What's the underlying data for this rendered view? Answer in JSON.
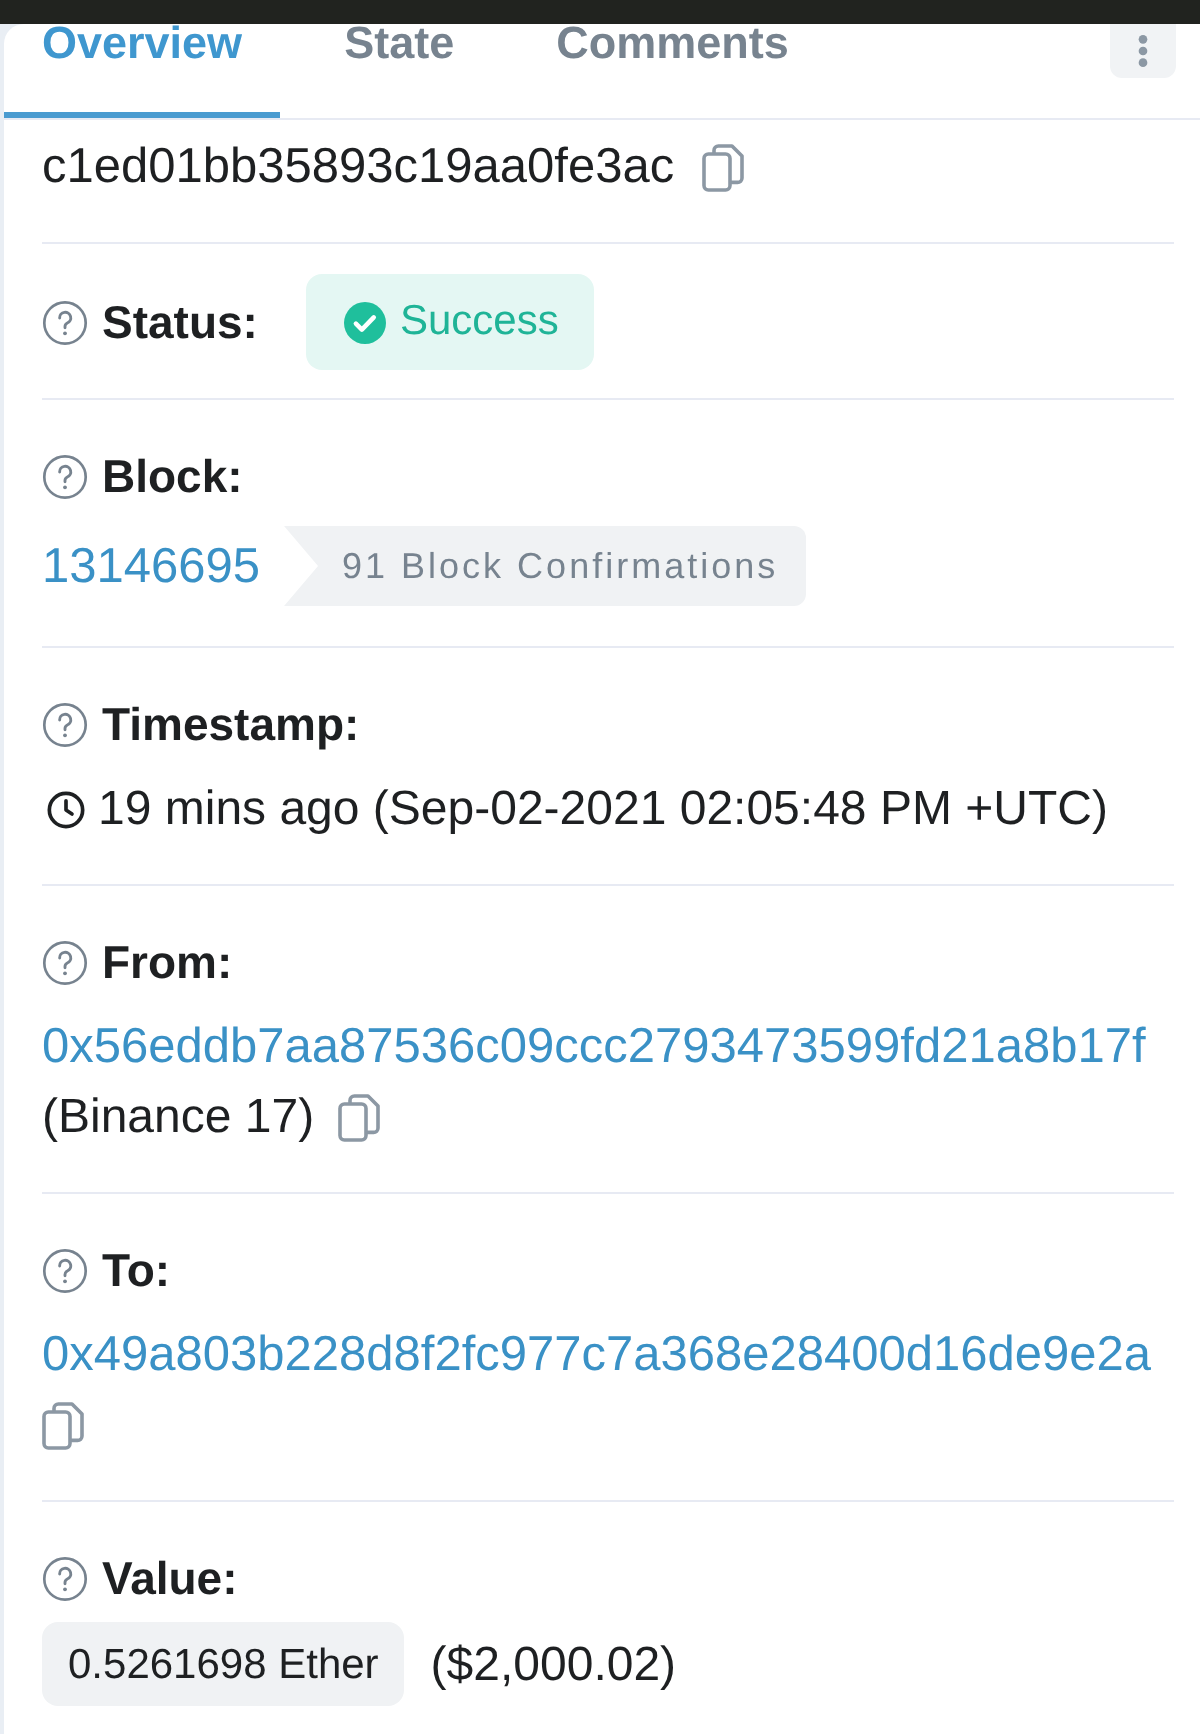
{
  "tabs": [
    {
      "label": "Overview",
      "selected": true
    },
    {
      "label": "State",
      "selected": false
    },
    {
      "label": "Comments",
      "selected": false
    }
  ],
  "hash": "c1ed01bb35893c19aa0fe3ac",
  "fields": [
    {
      "kind": "status",
      "label": "Status:",
      "value": "Success"
    },
    {
      "kind": "block",
      "label": "Block:",
      "value": "13146695",
      "badge": "91 Block Confirmations"
    },
    {
      "kind": "timestamp",
      "label": "Timestamp:",
      "value": "19 mins ago (Sep-02-2021 02:05:48 PM +UTC)"
    },
    {
      "kind": "address",
      "label": "From:",
      "value": "0x56eddb7aa87536c09ccc2793473599fd21a8b17f",
      "note": "(Binance 17)"
    },
    {
      "kind": "address",
      "label": "To:",
      "value": "0x49a803b228d8f2fc977c7a368e28400d16de9e2a"
    },
    {
      "kind": "amount",
      "label": "Value:",
      "value": "0.5261698 Ether",
      "note": "($2,000.02)"
    }
  ]
}
